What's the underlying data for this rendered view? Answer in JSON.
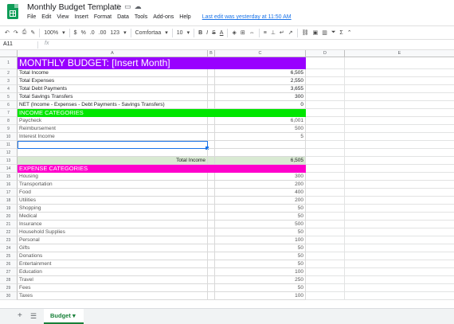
{
  "doc": {
    "title": "Monthly Budget Template",
    "menu": [
      "File",
      "Edit",
      "View",
      "Insert",
      "Format",
      "Data",
      "Tools",
      "Add-ons",
      "Help"
    ],
    "last_edit": "Last edit was yesterday at 11:50 AM"
  },
  "toolbar": {
    "zoom": "100%",
    "currency": "$",
    "percent": "%",
    "decimal_dec": ".0",
    "decimal_inc": ".00",
    "number_format": "123",
    "font": "Comfortaa",
    "font_size": "10",
    "bold": "B",
    "italic": "I",
    "strike": "S",
    "text_color": "A"
  },
  "formula_bar": {
    "cell_ref": "A11",
    "fx": "fx",
    "value": ""
  },
  "columns": {
    "a": "A",
    "b": "B",
    "c": "C",
    "d": "D",
    "e": "E"
  },
  "rows": [
    {
      "n": "1",
      "label": "MONTHLY BUDGET: [Insert Month]",
      "value": ""
    },
    {
      "n": "2",
      "label": "Total Income",
      "value": "6,505"
    },
    {
      "n": "3",
      "label": "Total Expenses",
      "value": "2,550"
    },
    {
      "n": "4",
      "label": "Total Debt Payments",
      "value": "3,655"
    },
    {
      "n": "5",
      "label": "Total Savings Transfers",
      "value": "300"
    },
    {
      "n": "6",
      "label": "NET (Income - Expenses - Debt Payments - Savings Transfers)",
      "value": "0"
    },
    {
      "n": "7",
      "label": "INCOME CATEGORIES",
      "value": ""
    },
    {
      "n": "8",
      "label": "Paycheck",
      "value": "6,001"
    },
    {
      "n": "9",
      "label": "Reimbursement",
      "value": "500"
    },
    {
      "n": "10",
      "label": "Interest Income",
      "value": "5"
    },
    {
      "n": "11",
      "label": "",
      "value": ""
    },
    {
      "n": "12",
      "label": "",
      "value": ""
    },
    {
      "n": "13",
      "label": "Total Income",
      "value": "6,505"
    },
    {
      "n": "14",
      "label": "EXPENSE CATEGORIES",
      "value": ""
    },
    {
      "n": "15",
      "label": "Housing",
      "value": "300"
    },
    {
      "n": "16",
      "label": "Transportation",
      "value": "200"
    },
    {
      "n": "17",
      "label": "Food",
      "value": "400"
    },
    {
      "n": "18",
      "label": "Utilities",
      "value": "200"
    },
    {
      "n": "19",
      "label": "Shopping",
      "value": "50"
    },
    {
      "n": "20",
      "label": "Medical",
      "value": "50"
    },
    {
      "n": "21",
      "label": "Insurance",
      "value": "500"
    },
    {
      "n": "22",
      "label": "Household Supplies",
      "value": "50"
    },
    {
      "n": "23",
      "label": "Personal",
      "value": "100"
    },
    {
      "n": "24",
      "label": "Gifts",
      "value": "50"
    },
    {
      "n": "25",
      "label": "Donations",
      "value": "50"
    },
    {
      "n": "26",
      "label": "Entertainment",
      "value": "50"
    },
    {
      "n": "27",
      "label": "Education",
      "value": "100"
    },
    {
      "n": "28",
      "label": "Travel",
      "value": "250"
    },
    {
      "n": "29",
      "label": "Fees",
      "value": "50"
    },
    {
      "n": "30",
      "label": "Taxes",
      "value": "100"
    }
  ],
  "sheet_tab": {
    "label": "Budget"
  },
  "colors": {
    "title_bg": "#9900ff",
    "income_bg": "#00e600",
    "expense_bg": "#ff00cc",
    "total_bg": "#d9ead3",
    "accent": "#188038"
  }
}
